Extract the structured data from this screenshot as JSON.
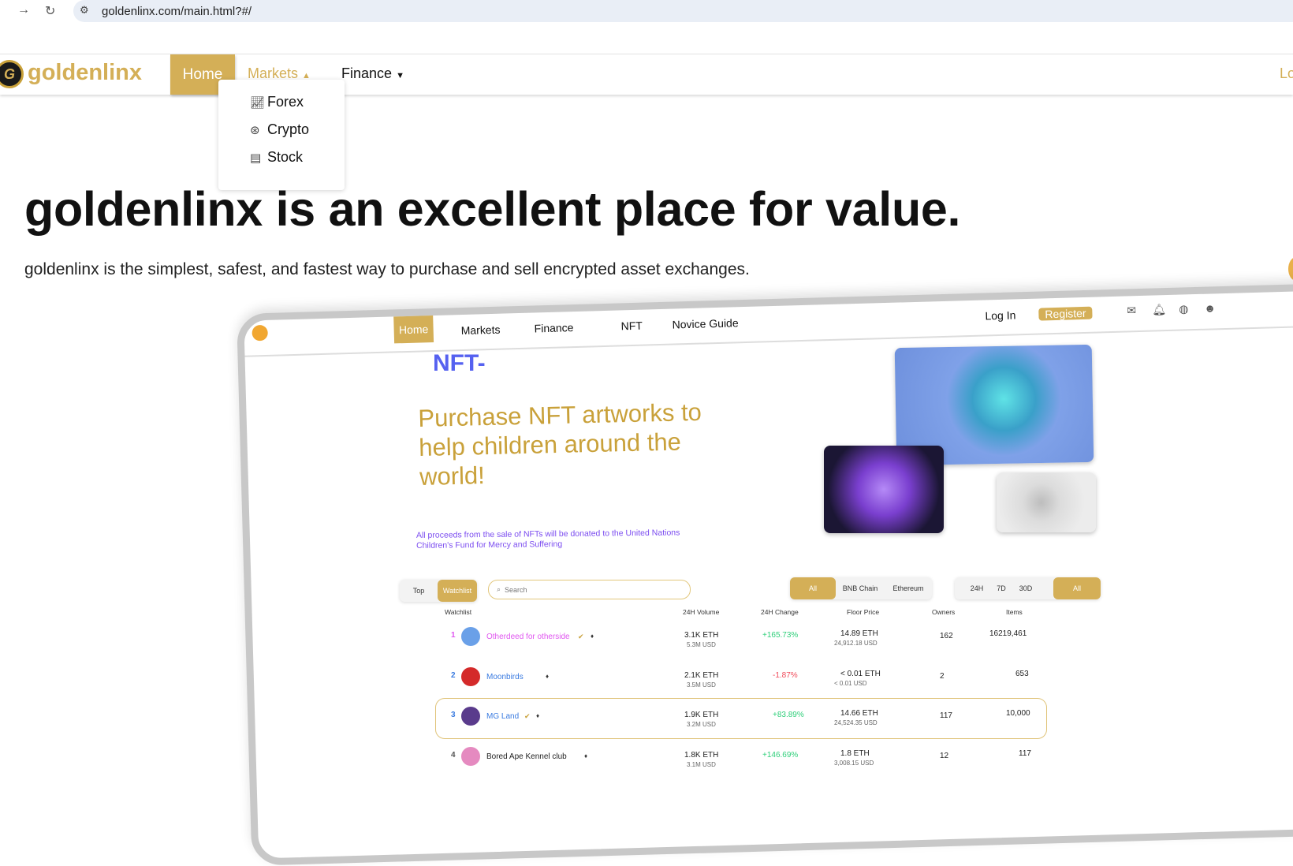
{
  "browser": {
    "url": "goldenlinx.com/main.html?#/"
  },
  "site": {
    "logo": "goldenlinx",
    "logo_mark": "G",
    "nav": {
      "home": "Home",
      "markets": "Markets",
      "finance": "Finance",
      "login_partial": "Lo"
    },
    "markets_menu": [
      {
        "label": "Forex",
        "icon": "chart-icon"
      },
      {
        "label": "Crypto",
        "icon": "coin-icon"
      },
      {
        "label": "Stock",
        "icon": "stock-document-icon"
      }
    ]
  },
  "hero": {
    "title": "goldenlinx is an excellent place for value.",
    "subtitle": "goldenlinx is the simplest, safest, and fastest way to purchase and sell encrypted asset exchanges."
  },
  "mockup": {
    "nav": {
      "home": "Home",
      "markets": "Markets",
      "finance": "Finance",
      "nft": "NFT",
      "novice": "Novice Guide",
      "login": "Log In",
      "register": "Register"
    },
    "nft_title": "NFT-",
    "headline": "Purchase NFT artworks to help children around the world!",
    "caption": "All proceeds from the sale of NFTs will be donated to the United Nations Children's Fund for Mercy and Suffering",
    "tabs": {
      "top": "Top",
      "watchlist": "Watchlist"
    },
    "search_placeholder": "Search",
    "chains": [
      "All",
      "BNB Chain",
      "Ethereum"
    ],
    "times": [
      "24H",
      "7D",
      "30D",
      "All"
    ],
    "headers": {
      "watchlist": "Watchlist",
      "volume": "24H Volume",
      "change": "24H Change",
      "floor": "Floor Price",
      "owners": "Owners",
      "items": "Items"
    },
    "rows": [
      {
        "rank": "1",
        "name": "Otherdeed for otherside",
        "volume": "3.1K ETH",
        "volume_usd": "5.3M USD",
        "change": "+165.73%",
        "floor": "14.89 ETH",
        "floor_usd": "24,912.18 USD",
        "owners": "162",
        "items": "16219,461",
        "name_color": "#e056f0",
        "change_color": "#2fcf7a"
      },
      {
        "rank": "2",
        "name": "Moonbirds",
        "volume": "2.1K ETH",
        "volume_usd": "3.5M USD",
        "change": "-1.87%",
        "floor": "< 0.01 ETH",
        "floor_usd": "< 0.01 USD",
        "owners": "2",
        "items": "653",
        "name_color": "#3a7be0",
        "change_color": "#f04a5a"
      },
      {
        "rank": "3",
        "name": "MG Land",
        "volume": "1.9K ETH",
        "volume_usd": "3.2M USD",
        "change": "+83.89%",
        "floor": "14.66 ETH",
        "floor_usd": "24,524.35 USD",
        "owners": "117",
        "items": "10,000",
        "name_color": "#3a7be0",
        "change_color": "#2fcf7a"
      },
      {
        "rank": "4",
        "name": "Bored Ape Kennel club",
        "volume": "1.8K ETH",
        "volume_usd": "3.1M USD",
        "change": "+146.69%",
        "floor": "1.8 ETH",
        "floor_usd": "3,008.15 USD",
        "owners": "12",
        "items": "117",
        "name_color": "#222222",
        "change_color": "#2fcf7a"
      }
    ]
  },
  "colors": {
    "gold": "#d4af57",
    "nft_blue": "#5561f0",
    "caption_purple": "#7b4cf0"
  }
}
